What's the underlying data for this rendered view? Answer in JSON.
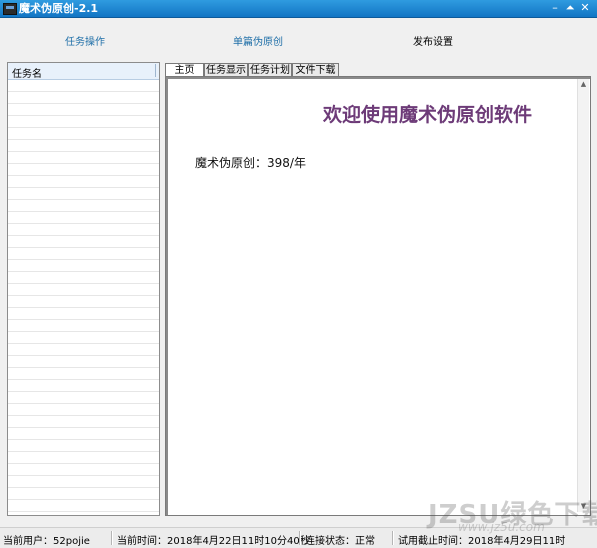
{
  "window": {
    "title": "魔术伪原创-2.1",
    "min_symbol": "–",
    "max_symbol": "⏶",
    "close_symbol": "✕",
    "title_bar_color": "#1a86d4"
  },
  "menu": {
    "items": [
      {
        "label": "任务操作"
      },
      {
        "label": "单篇伪原创"
      },
      {
        "label": "发布设置"
      }
    ]
  },
  "task_list": {
    "column_header": "任务名"
  },
  "tabs": [
    {
      "label": "主页",
      "active": true
    },
    {
      "label": "任务显示",
      "active": false
    },
    {
      "label": "任务计划",
      "active": false
    },
    {
      "label": "文件下载",
      "active": false
    }
  ],
  "home": {
    "welcome": "欢迎使用魔术伪原创软件",
    "price": "魔术伪原创：398/年",
    "welcome_color": "#6d3b78"
  },
  "scrollbar": {
    "up_symbol": "▲",
    "down_symbol": "▼"
  },
  "status": {
    "user": "当前用户：52pojie",
    "time": "当前时间：2018年4月22日11时10分40秒",
    "connection": "连接状态：正常",
    "trial_end": "试用截止时间：2018年4月29日11时"
  },
  "watermark": {
    "main": "JZSU绿色下载",
    "sub": "www.jz5u.com"
  }
}
